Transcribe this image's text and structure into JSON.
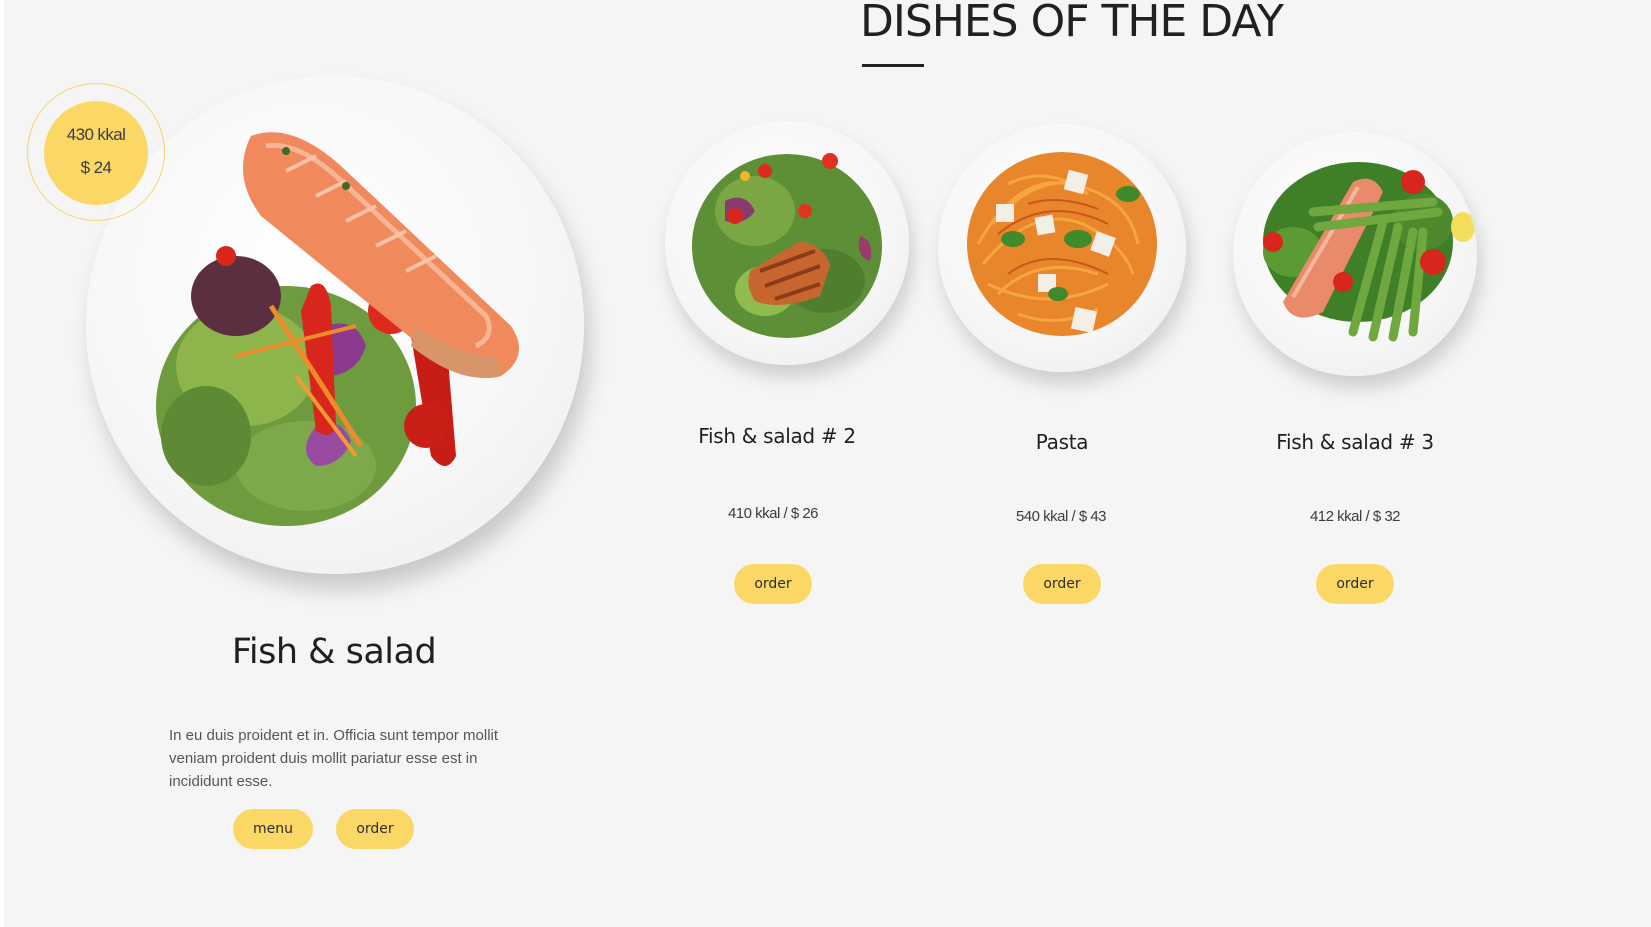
{
  "section": {
    "title": "DISHES OF THE DAY"
  },
  "featured": {
    "kcal": "430 kkal",
    "price": "$ 24",
    "name": "Fish & salad",
    "description": "In eu duis proident et in. Officia sunt tempor mollit veniam proident duis mollit pariatur esse est in incididunt esse.",
    "menu_label": "menu",
    "order_label": "order",
    "image": "salmon-salad-plate"
  },
  "dishes": [
    {
      "name": "Fish & salad # 2",
      "meta": "410 kkal / $ 26",
      "order_label": "order",
      "image": "grilled-fish-salad-plate"
    },
    {
      "name": "Pasta",
      "meta": "540 kkal / $ 43",
      "order_label": "order",
      "image": "spaghetti-plate"
    },
    {
      "name": "Fish & salad # 3",
      "meta": "412 kkal / $ 32",
      "order_label": "order",
      "image": "salmon-asparagus-plate"
    }
  ],
  "colors": {
    "accent": "#fbd865",
    "background": "#f5f5f5",
    "text": "#1f1f24"
  }
}
